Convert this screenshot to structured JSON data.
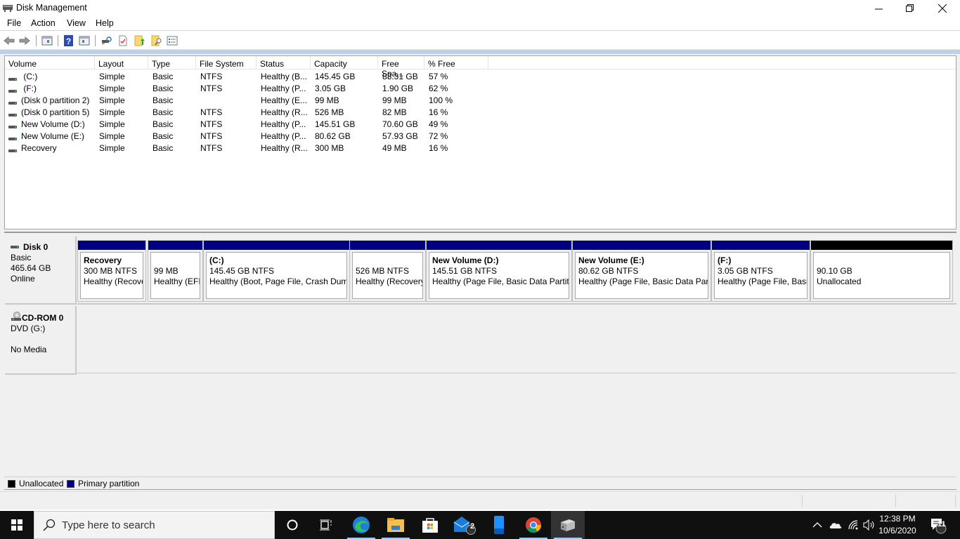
{
  "window": {
    "title": "Disk Management",
    "controls": {
      "minimize": "minimize",
      "restore": "restore",
      "close": "close"
    }
  },
  "menu": [
    "File",
    "Action",
    "View",
    "Help"
  ],
  "toolbar": {
    "icons": [
      "back-icon",
      "forward-icon",
      "show-hide-console-tree-icon",
      "help-icon",
      "show-hide-action-pane-icon",
      "connect-disk-icon",
      "check-properties-icon",
      "folder-up-icon",
      "search-folder-icon",
      "list-properties-icon"
    ]
  },
  "volume_list": {
    "columns": [
      "Volume",
      "Layout",
      "Type",
      "File System",
      "Status",
      "Capacity",
      "Free Spa...",
      "% Free"
    ],
    "rows": [
      {
        "volume": " (C:)",
        "layout": "Simple",
        "type": "Basic",
        "fs": "NTFS",
        "status": "Healthy (B...",
        "capacity": "145.45 GB",
        "free": "83.31 GB",
        "pct": "57 %"
      },
      {
        "volume": " (F:)",
        "layout": "Simple",
        "type": "Basic",
        "fs": "NTFS",
        "status": "Healthy (P...",
        "capacity": "3.05 GB",
        "free": "1.90 GB",
        "pct": "62 %"
      },
      {
        "volume": "(Disk 0 partition 2)",
        "layout": "Simple",
        "type": "Basic",
        "fs": "",
        "status": "Healthy (E...",
        "capacity": "99 MB",
        "free": "99 MB",
        "pct": "100 %"
      },
      {
        "volume": "(Disk 0 partition 5)",
        "layout": "Simple",
        "type": "Basic",
        "fs": "NTFS",
        "status": "Healthy (R...",
        "capacity": "526 MB",
        "free": "82 MB",
        "pct": "16 %"
      },
      {
        "volume": "New Volume (D:)",
        "layout": "Simple",
        "type": "Basic",
        "fs": "NTFS",
        "status": "Healthy (P...",
        "capacity": "145.51 GB",
        "free": "70.60 GB",
        "pct": "49 %"
      },
      {
        "volume": "New Volume (E:)",
        "layout": "Simple",
        "type": "Basic",
        "fs": "NTFS",
        "status": "Healthy (P...",
        "capacity": "80.62 GB",
        "free": "57.93 GB",
        "pct": "72 %"
      },
      {
        "volume": "Recovery",
        "layout": "Simple",
        "type": "Basic",
        "fs": "NTFS",
        "status": "Healthy (R...",
        "capacity": "300 MB",
        "free": "49 MB",
        "pct": "16 %"
      }
    ]
  },
  "disks": [
    {
      "name": "Disk 0",
      "type": "Basic",
      "size": "465.64 GB",
      "state": "Online",
      "partitions": [
        {
          "label": "Recovery",
          "size": "300 MB NTFS",
          "status": "Healthy (Recove",
          "kind": "primary"
        },
        {
          "label": "",
          "size": "99 MB",
          "status": "Healthy (EFI",
          "kind": "primary"
        },
        {
          "label": " (C:)",
          "size": "145.45 GB NTFS",
          "status": "Healthy (Boot, Page File, Crash Dum",
          "kind": "primary"
        },
        {
          "label": "",
          "size": "526 MB NTFS",
          "status": "Healthy (Recovery",
          "kind": "primary"
        },
        {
          "label": "New Volume  (D:)",
          "size": "145.51 GB NTFS",
          "status": "Healthy (Page File, Basic Data Partitic",
          "kind": "primary"
        },
        {
          "label": "New Volume  (E:)",
          "size": "80.62 GB NTFS",
          "status": "Healthy (Page File, Basic Data Parti",
          "kind": "primary"
        },
        {
          "label": " (F:)",
          "size": "3.05 GB NTFS",
          "status": "Healthy (Page File, Basic",
          "kind": "primary"
        },
        {
          "label": "",
          "size": "90.10 GB",
          "status": "Unallocated",
          "kind": "unallocated"
        }
      ]
    },
    {
      "name": "CD-ROM 0",
      "type": "DVD (G:)",
      "size": "",
      "state": "No Media"
    }
  ],
  "legend": [
    {
      "label": "Unallocated",
      "color": "#000000"
    },
    {
      "label": "Primary partition",
      "color": "#000080"
    }
  ],
  "colors": {
    "primary": "#000080",
    "unallocated": "#000000"
  },
  "taskbar": {
    "search_placeholder": "Type here to search",
    "apps": [
      "cortana",
      "task-view",
      "edge",
      "file-explorer",
      "microsoft-store",
      "mail",
      "your-phone",
      "chrome",
      "disk-management"
    ],
    "mail_badge": "2",
    "notification_count": "11",
    "time": "12:38 PM",
    "date": "10/6/2020"
  }
}
